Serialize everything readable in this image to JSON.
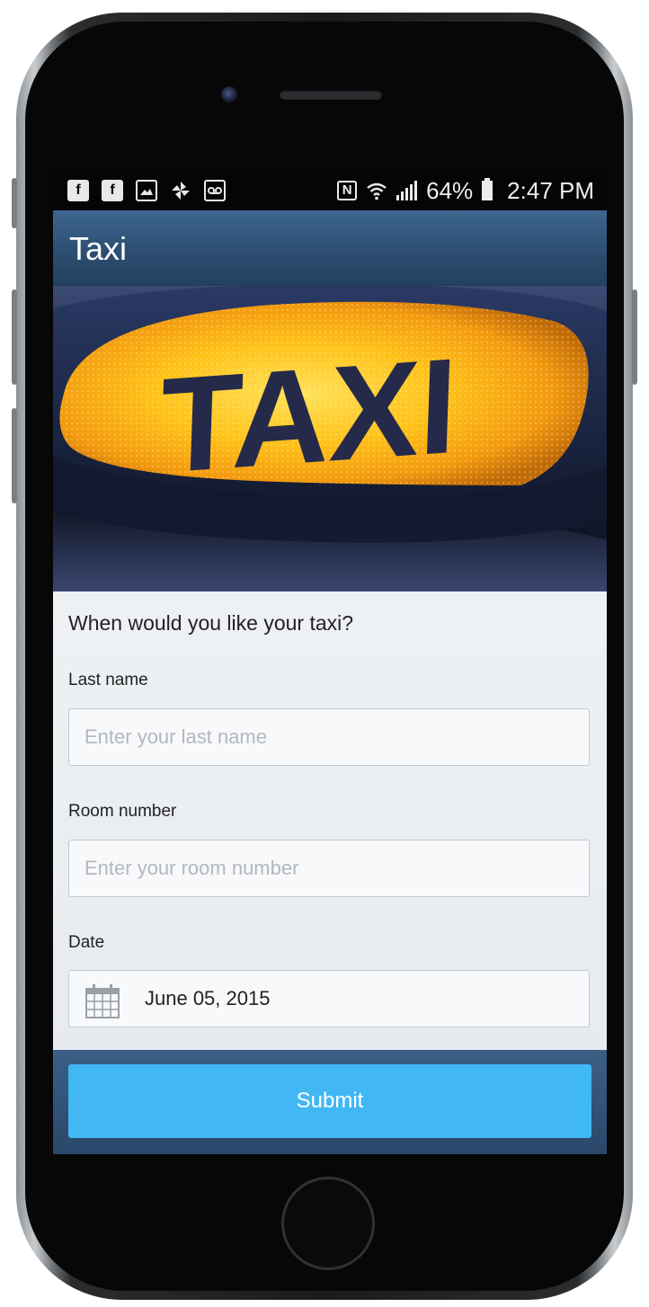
{
  "statusbar": {
    "notification_icons": [
      "facebook-icon",
      "facebook-icon",
      "image-icon",
      "pinwheel-icon",
      "voicemail-icon"
    ],
    "battery": "64%",
    "time": "2:47 PM"
  },
  "app": {
    "title": "Taxi"
  },
  "hero": {
    "sign_text": "TAXI"
  },
  "form": {
    "question": "When would you like your taxi?",
    "last_name": {
      "label": "Last name",
      "placeholder": "Enter your last name",
      "value": ""
    },
    "room_number": {
      "label": "Room number",
      "placeholder": "Enter your room number",
      "value": ""
    },
    "date": {
      "label": "Date",
      "value": "June 05, 2015"
    }
  },
  "actions": {
    "submit_label": "Submit"
  },
  "colors": {
    "appbar": "#2c4c6f",
    "submit": "#41b7f4",
    "form_bg": "#e9edf1"
  }
}
